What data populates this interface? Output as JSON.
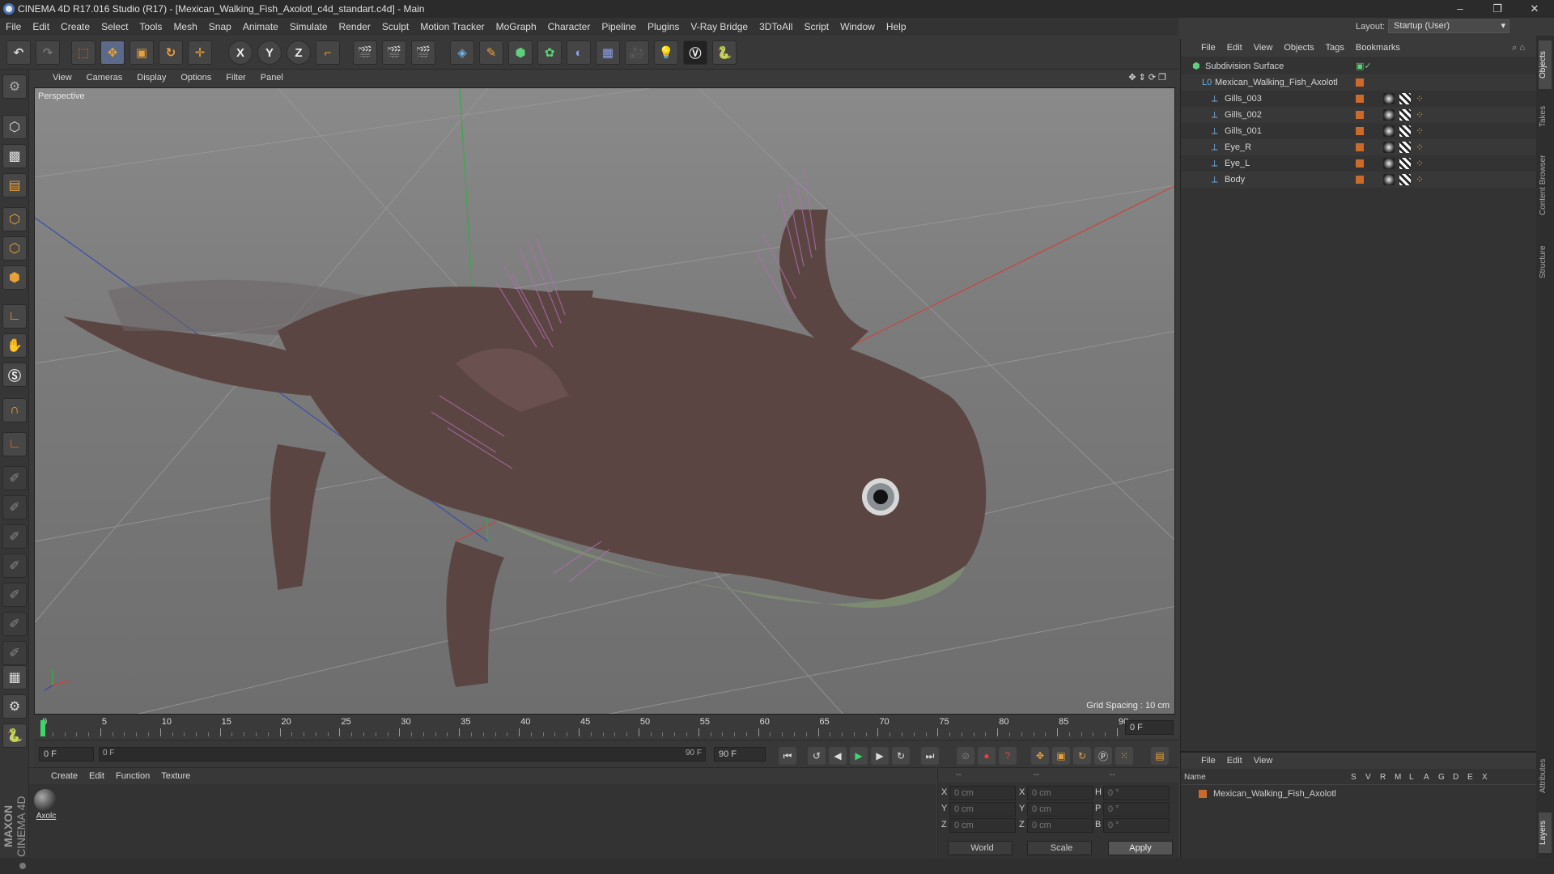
{
  "window": {
    "title": "CINEMA 4D R17.016 Studio (R17) - [Mexican_Walking_Fish_Axolotl_c4d_standart.c4d] - Main",
    "minimize": "–",
    "maximize": "❐",
    "close": "✕"
  },
  "menubar": [
    "File",
    "Edit",
    "Create",
    "Select",
    "Tools",
    "Mesh",
    "Snap",
    "Animate",
    "Simulate",
    "Render",
    "Sculpt",
    "Motion Tracker",
    "MoGraph",
    "Character",
    "Pipeline",
    "Plugins",
    "V-Ray Bridge",
    "3DToAll",
    "Script",
    "Window",
    "Help"
  ],
  "layout": {
    "label": "Layout:",
    "value": "Startup (User)"
  },
  "toolbar": {
    "axis_x": "X",
    "axis_y": "Y",
    "axis_z": "Z",
    "icons": [
      "undo-icon",
      "redo-icon",
      "select-icon",
      "move-icon",
      "scale-icon",
      "rotate-icon",
      "transform-icon",
      "axis-x-icon",
      "axis-y-icon",
      "axis-z-icon",
      "coord-system-icon",
      "render-view-icon",
      "render-picture-viewer-icon",
      "render-settings-icon",
      "cube-icon",
      "pen-icon",
      "subdivision-icon",
      "array-icon",
      "deformer-icon",
      "floor-icon",
      "camera-icon",
      "light-icon",
      "vray-icon",
      "python-icon"
    ]
  },
  "viewport": {
    "menu": [
      "View",
      "Cameras",
      "Display",
      "Options",
      "Filter",
      "Panel"
    ],
    "label": "Perspective",
    "grid_spacing": "Grid Spacing : 10 cm"
  },
  "timeline": {
    "ticks": [
      "0",
      "5",
      "10",
      "15",
      "20",
      "25",
      "30",
      "35",
      "40",
      "45",
      "50",
      "55",
      "60",
      "65",
      "70",
      "75",
      "80",
      "85",
      "90"
    ],
    "current_frame": "0 F",
    "start_field": "0 F",
    "slider_start": "0 F",
    "slider_end": "90 F",
    "end_field": "90 F"
  },
  "materials": {
    "menu": [
      "Create",
      "Edit",
      "Function",
      "Texture"
    ],
    "items": [
      {
        "name": "Axolc"
      }
    ]
  },
  "coordinates": {
    "header": [
      "--",
      "--",
      "--"
    ],
    "rows": [
      {
        "a": "X",
        "av": "0 cm",
        "b": "X",
        "bv": "0 cm",
        "c": "H",
        "cv": "0 °"
      },
      {
        "a": "Y",
        "av": "0 cm",
        "b": "Y",
        "bv": "0 cm",
        "c": "P",
        "cv": "0 °"
      },
      {
        "a": "Z",
        "av": "0 cm",
        "b": "Z",
        "bv": "0 cm",
        "c": "B",
        "cv": "0 °"
      }
    ],
    "world": "World",
    "scale": "Scale",
    "apply": "Apply"
  },
  "objects": {
    "menu": [
      "File",
      "Edit",
      "View",
      "Objects",
      "Tags",
      "Bookmarks"
    ],
    "tree": [
      {
        "name": "Subdivision Surface",
        "level": 0
      },
      {
        "name": "Mexican_Walking_Fish_Axolotl",
        "level": 1
      },
      {
        "name": "Gills_003",
        "level": 2
      },
      {
        "name": "Gills_002",
        "level": 2
      },
      {
        "name": "Gills_001",
        "level": 2
      },
      {
        "name": "Eye_R",
        "level": 2
      },
      {
        "name": "Eye_L",
        "level": 2
      },
      {
        "name": "Body",
        "level": 2
      }
    ]
  },
  "layers": {
    "menu": [
      "File",
      "Edit",
      "View"
    ],
    "columns": [
      "Name",
      "S",
      "V",
      "R",
      "M",
      "L",
      "A",
      "G",
      "D",
      "E",
      "X"
    ],
    "rows": [
      {
        "name": "Mexican_Walking_Fish_Axolotl"
      }
    ]
  },
  "right_tabs": [
    "Objects",
    "Takes",
    "Content Browser",
    "Structure",
    "Attributes",
    "Layers"
  ],
  "brand": {
    "maxon": "MAXON",
    "product": "CINEMA 4D"
  },
  "colors": {
    "accent_orange": "#cc6a2a",
    "selection_blue": "#4a76b8",
    "axolotl_body": "#5b4542"
  }
}
